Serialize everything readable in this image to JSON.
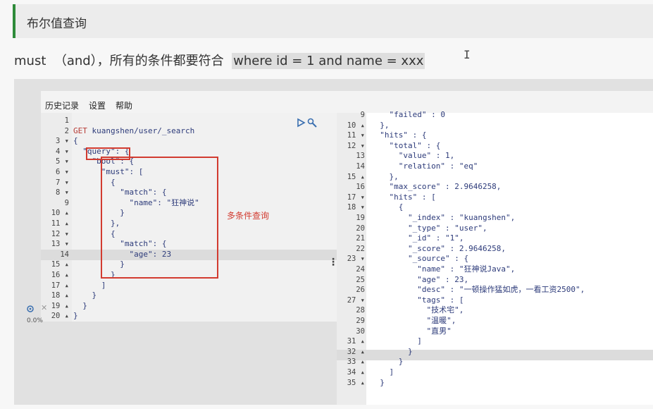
{
  "section_title": "布尔值查询",
  "description": {
    "main": "must  （and），所有的条件都要符合  ",
    "highlight": "where id = 1 and name = xxx"
  },
  "menu": [
    "历史记录",
    "设置",
    "帮助"
  ],
  "annotation": "多条件查询",
  "progress_label": "0.0%",
  "icons": {
    "run": "play-icon",
    "wrench": "wrench-icon",
    "settings": "gear-icon",
    "close": "close-icon",
    "drag": "drag-handle-icon",
    "cursor": "text-cursor-icon"
  },
  "request": {
    "lines": [
      {
        "n": "1",
        "t": ""
      },
      {
        "n": "2",
        "t": "GET kuangshen/user/_search"
      },
      {
        "n": "3 ▾",
        "t": "{"
      },
      {
        "n": "4 ▾",
        "t": "  \"query\": {"
      },
      {
        "n": "5 ▾",
        "t": "    \"bool\": {"
      },
      {
        "n": "6 ▾",
        "t": "      \"must\": ["
      },
      {
        "n": "7 ▾",
        "t": "        {"
      },
      {
        "n": "8 ▾",
        "t": "          \"match\": {"
      },
      {
        "n": "9",
        "t": "            \"name\": \"狂神说\""
      },
      {
        "n": "10 ▴",
        "t": "          }"
      },
      {
        "n": "11 ▴",
        "t": "        },"
      },
      {
        "n": "12 ▾",
        "t": "        {"
      },
      {
        "n": "13 ▾",
        "t": "          \"match\": {"
      },
      {
        "n": "14",
        "t": "            \"age\": 23"
      },
      {
        "n": "15 ▴",
        "t": "          }"
      },
      {
        "n": "16 ▴",
        "t": "        }"
      },
      {
        "n": "17 ▴",
        "t": "      ]"
      },
      {
        "n": "18 ▴",
        "t": "    }"
      },
      {
        "n": "19 ▴",
        "t": "  }"
      },
      {
        "n": "20 ▴",
        "t": "}"
      }
    ]
  },
  "response": {
    "lines": [
      {
        "n": "9",
        "t": "    \"failed\" : 0"
      },
      {
        "n": "10 ▴",
        "t": "  },"
      },
      {
        "n": "11 ▾",
        "t": "  \"hits\" : {"
      },
      {
        "n": "12 ▾",
        "t": "    \"total\" : {"
      },
      {
        "n": "13",
        "t": "      \"value\" : 1,"
      },
      {
        "n": "14",
        "t": "      \"relation\" : \"eq\""
      },
      {
        "n": "15 ▴",
        "t": "    },"
      },
      {
        "n": "16",
        "t": "    \"max_score\" : 2.9646258,"
      },
      {
        "n": "17 ▾",
        "t": "    \"hits\" : ["
      },
      {
        "n": "18 ▾",
        "t": "      {"
      },
      {
        "n": "19",
        "t": "        \"_index\" : \"kuangshen\","
      },
      {
        "n": "20",
        "t": "        \"_type\" : \"user\","
      },
      {
        "n": "21",
        "t": "        \"_id\" : \"1\","
      },
      {
        "n": "22",
        "t": "        \"_score\" : 2.9646258,"
      },
      {
        "n": "23 ▾",
        "t": "        \"_source\" : {"
      },
      {
        "n": "24",
        "t": "          \"name\" : \"狂神说Java\","
      },
      {
        "n": "25",
        "t": "          \"age\" : 23,"
      },
      {
        "n": "26",
        "t": "          \"desc\" : \"一顿操作猛如虎，一看工资2500\","
      },
      {
        "n": "27 ▾",
        "t": "          \"tags\" : ["
      },
      {
        "n": "28",
        "t": "            \"技术宅\","
      },
      {
        "n": "29",
        "t": "            \"温暖\","
      },
      {
        "n": "30",
        "t": "            \"直男\""
      },
      {
        "n": "31 ▴",
        "t": "          ]"
      },
      {
        "n": "32 ▴",
        "t": "        }"
      },
      {
        "n": "33 ▴",
        "t": "      }"
      },
      {
        "n": "34 ▴",
        "t": "    ]"
      },
      {
        "n": "35 ▴",
        "t": "  }"
      }
    ]
  }
}
